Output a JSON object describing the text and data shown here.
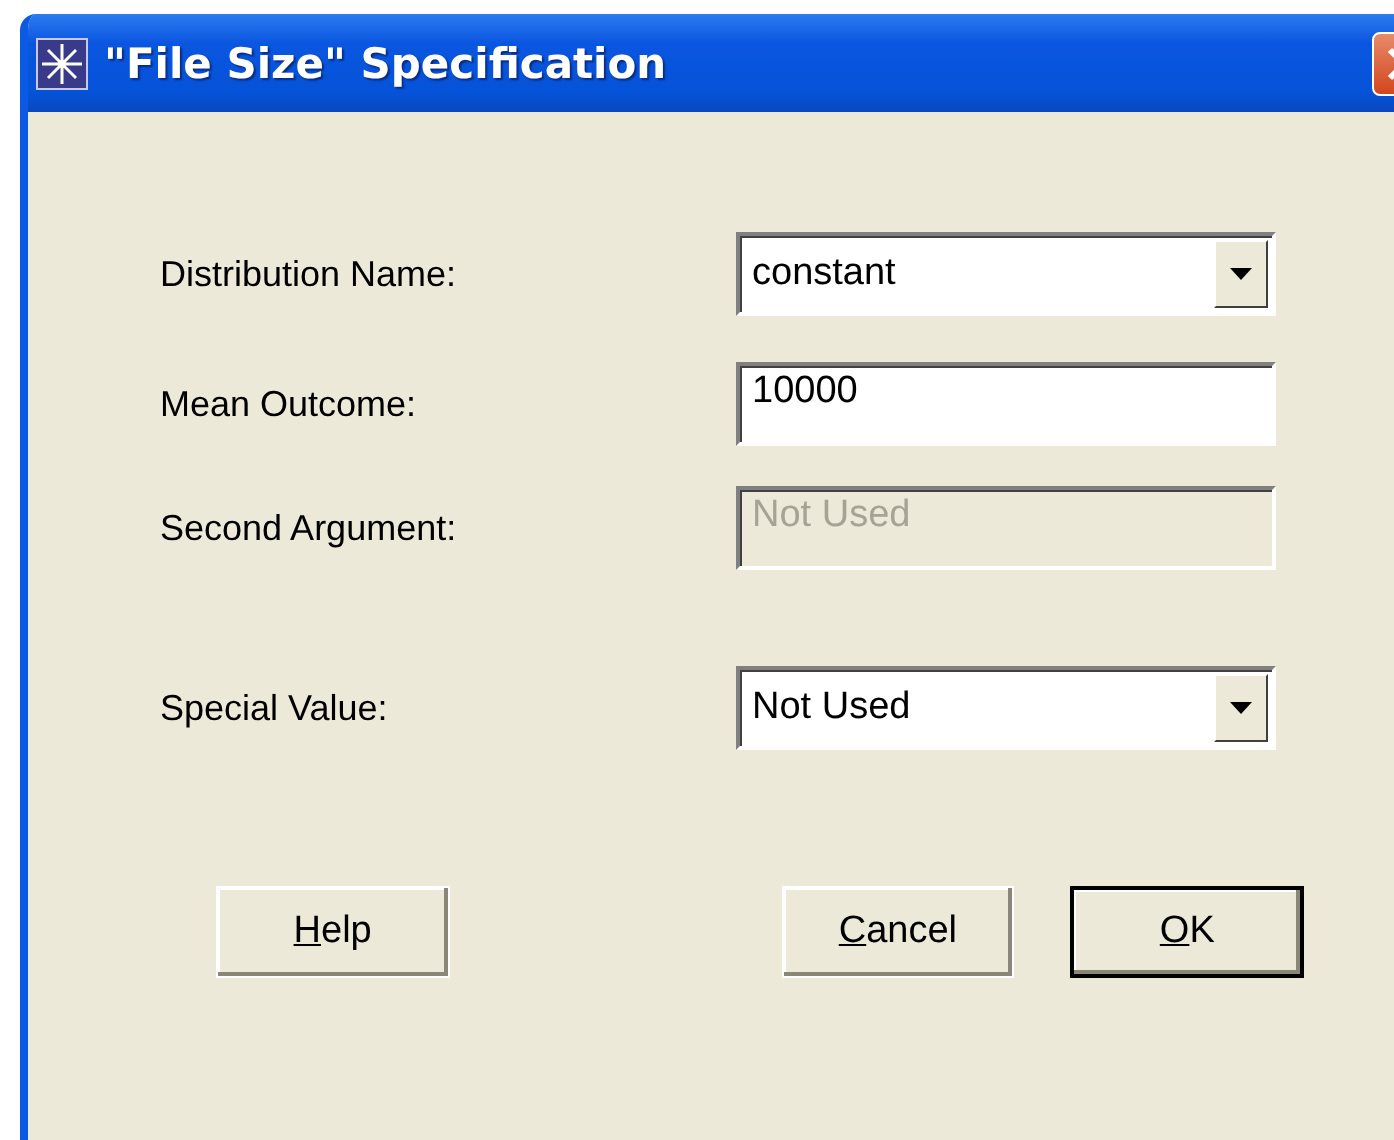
{
  "window": {
    "title": "\"File Size\" Specification"
  },
  "fields": [
    {
      "label": "Distribution Name:",
      "kind": "dropdown",
      "value": "constant",
      "disabled": false
    },
    {
      "label": "Mean Outcome:",
      "kind": "text",
      "value": "10000",
      "disabled": false
    },
    {
      "label": "Second Argument:",
      "kind": "text",
      "value": "Not Used",
      "disabled": true
    },
    {
      "label": "Special Value:",
      "kind": "dropdown",
      "value": "Not Used",
      "disabled": false
    }
  ],
  "buttons": [
    {
      "label": "Help",
      "underline_first": true,
      "default": false
    },
    {
      "label": "Cancel",
      "underline_first": true,
      "default": false
    },
    {
      "label": "OK",
      "underline_first": true,
      "default": true
    }
  ]
}
